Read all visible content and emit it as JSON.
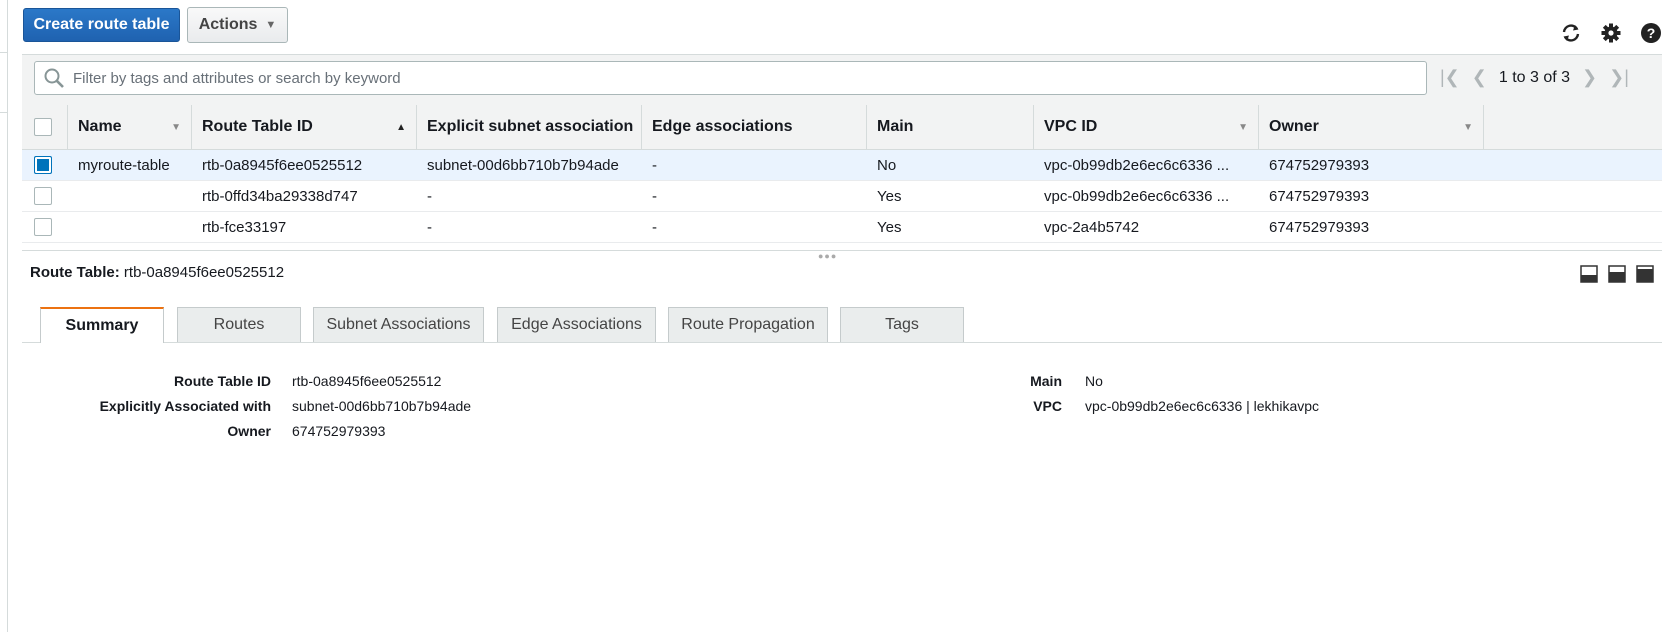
{
  "toolbar": {
    "create_label": "Create route table",
    "actions_label": "Actions"
  },
  "top_icons": [
    "refresh-icon",
    "settings-icon",
    "help-icon"
  ],
  "filter": {
    "placeholder": "Filter by tags and attributes or search by keyword",
    "value": ""
  },
  "pager": {
    "range": "1 to 3 of 3"
  },
  "table": {
    "headers": {
      "name": "Name",
      "route_table_id": "Route Table ID",
      "explicit_subnet": "Explicit subnet association",
      "edge": "Edge associations",
      "main": "Main",
      "vpc": "VPC ID",
      "owner": "Owner"
    },
    "rows": [
      {
        "name": "myroute-table",
        "route_table_id": "rtb-0a8945f6ee0525512",
        "explicit_subnet": "subnet-00d6bb710b7b94ade",
        "edge": "-",
        "main": "No",
        "vpc": "vpc-0b99db2e6ec6c6336 ...",
        "owner": "674752979393",
        "selected": true
      },
      {
        "name": "",
        "route_table_id": "rtb-0ffd34ba29338d747",
        "explicit_subnet": "-",
        "edge": "-",
        "main": "Yes",
        "vpc": "vpc-0b99db2e6ec6c6336 ...",
        "owner": "674752979393",
        "selected": false
      },
      {
        "name": "",
        "route_table_id": "rtb-fce33197",
        "explicit_subnet": "-",
        "edge": "-",
        "main": "Yes",
        "vpc": "vpc-2a4b5742",
        "owner": "674752979393",
        "selected": false
      }
    ]
  },
  "detail": {
    "title_label": "Route Table:",
    "title_value": "rtb-0a8945f6ee0525512",
    "tabs": [
      "Summary",
      "Routes",
      "Subnet Associations",
      "Edge Associations",
      "Route Propagation",
      "Tags"
    ],
    "active_tab": "Summary",
    "summary": {
      "route_table_id_label": "Route Table ID",
      "route_table_id": "rtb-0a8945f6ee0525512",
      "explicit_label": "Explicitly Associated with",
      "explicit": "subnet-00d6bb710b7b94ade",
      "owner_label": "Owner",
      "owner": "674752979393",
      "main_label": "Main",
      "main": "No",
      "vpc_label": "VPC",
      "vpc": "vpc-0b99db2e6ec6c6336 | lekhikavpc"
    }
  },
  "colors": {
    "primary": "#1f62b0",
    "link": "#0073bb",
    "tab_accent": "#ec7211",
    "selected_row": "#eaf3fe"
  }
}
